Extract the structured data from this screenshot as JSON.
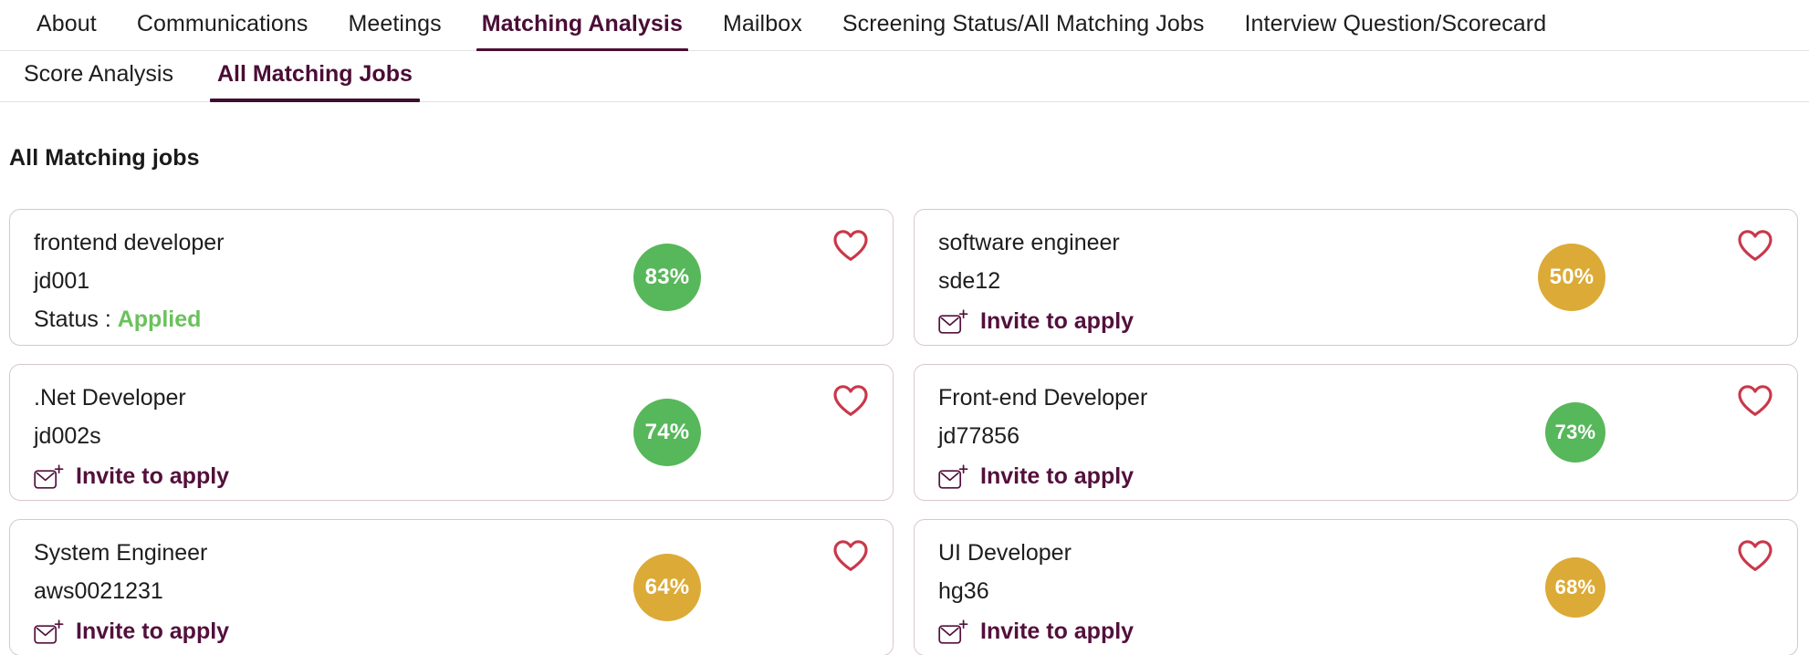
{
  "topnav": {
    "items": [
      {
        "label": "About",
        "active": false
      },
      {
        "label": "Communications",
        "active": false
      },
      {
        "label": "Meetings",
        "active": false
      },
      {
        "label": "Matching Analysis",
        "active": true
      },
      {
        "label": "Mailbox",
        "active": false
      },
      {
        "label": "Screening Status/All Matching Jobs",
        "active": false
      },
      {
        "label": "Interview Question/Scorecard",
        "active": false
      }
    ]
  },
  "subnav": {
    "items": [
      {
        "label": "Score Analysis",
        "active": false
      },
      {
        "label": "All Matching Jobs",
        "active": true
      }
    ]
  },
  "main": {
    "page_title": "All Matching jobs",
    "status_label": "Status :",
    "invite_label": "Invite to apply",
    "icons": {
      "invite": "envelope-plus-icon",
      "favorite": "heart-outline-icon"
    },
    "colors": {
      "accent": "#4a0d35",
      "invite_text": "#53103c",
      "badge_green": "#57b75b",
      "badge_gold": "#dcaa36",
      "status_applied": "#6ac25c",
      "heart_outline": "#c9384a",
      "card_border": "#d9c6d0"
    },
    "cards": [
      {
        "title": "frontend developer",
        "job_id": "jd001",
        "action": "status",
        "status_label": "Status :",
        "status_value": "Applied",
        "percent": "83%",
        "percent_color": "#57b75b",
        "badge_size": "large"
      },
      {
        "title": "software engineer",
        "job_id": "sde12",
        "action": "invite",
        "invite_label": "Invite to apply",
        "percent": "50%",
        "percent_color": "#dcaa36",
        "badge_size": "large"
      },
      {
        "title": ".Net Developer",
        "job_id": "jd002s",
        "action": "invite",
        "invite_label": "Invite to apply",
        "percent": "74%",
        "percent_color": "#57b75b",
        "badge_size": "large"
      },
      {
        "title": "Front-end Developer",
        "job_id": "jd77856",
        "action": "invite",
        "invite_label": "Invite to apply",
        "percent": "73%",
        "percent_color": "#57b75b",
        "badge_size": "small"
      },
      {
        "title": "System Engineer",
        "job_id": "aws0021231",
        "action": "invite",
        "invite_label": "Invite to apply",
        "percent": "64%",
        "percent_color": "#dcaa36",
        "badge_size": "large"
      },
      {
        "title": "UI Developer",
        "job_id": "hg36",
        "action": "invite",
        "invite_label": "Invite to apply",
        "percent": "68%",
        "percent_color": "#dcaa36",
        "badge_size": "small"
      }
    ]
  }
}
